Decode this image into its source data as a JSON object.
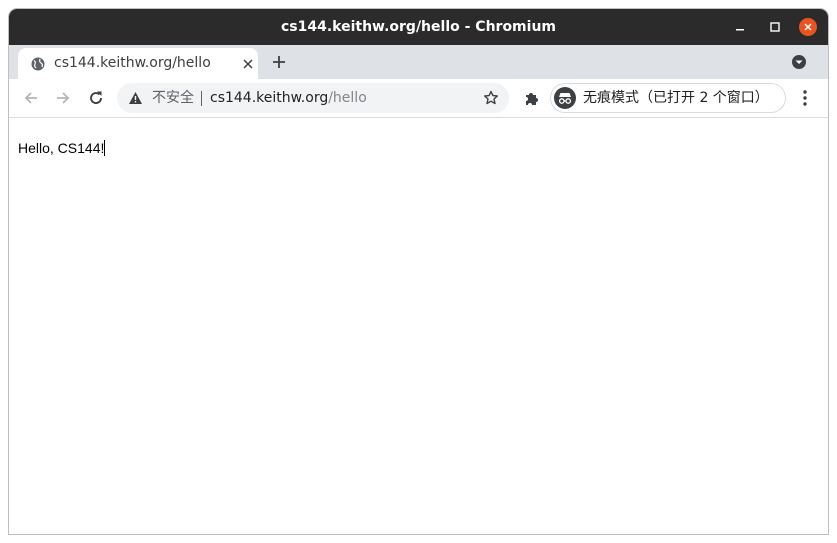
{
  "window": {
    "title": "cs144.keithw.org/hello - Chromium"
  },
  "tabs": [
    {
      "label": "cs144.keithw.org/hello",
      "favicon": "globe-icon"
    }
  ],
  "toolbar": {
    "security_label": "不安全",
    "url_host": "cs144.keithw.org",
    "url_path": "/hello",
    "incognito_label": "无痕模式（已打开 2 个窗口）"
  },
  "page": {
    "body_text": "Hello, CS144!"
  },
  "colors": {
    "titlebar": "#2b2b2b",
    "close_button": "#e95420",
    "tabstrip": "#dee1e6",
    "omnibox": "#f1f3f4"
  }
}
